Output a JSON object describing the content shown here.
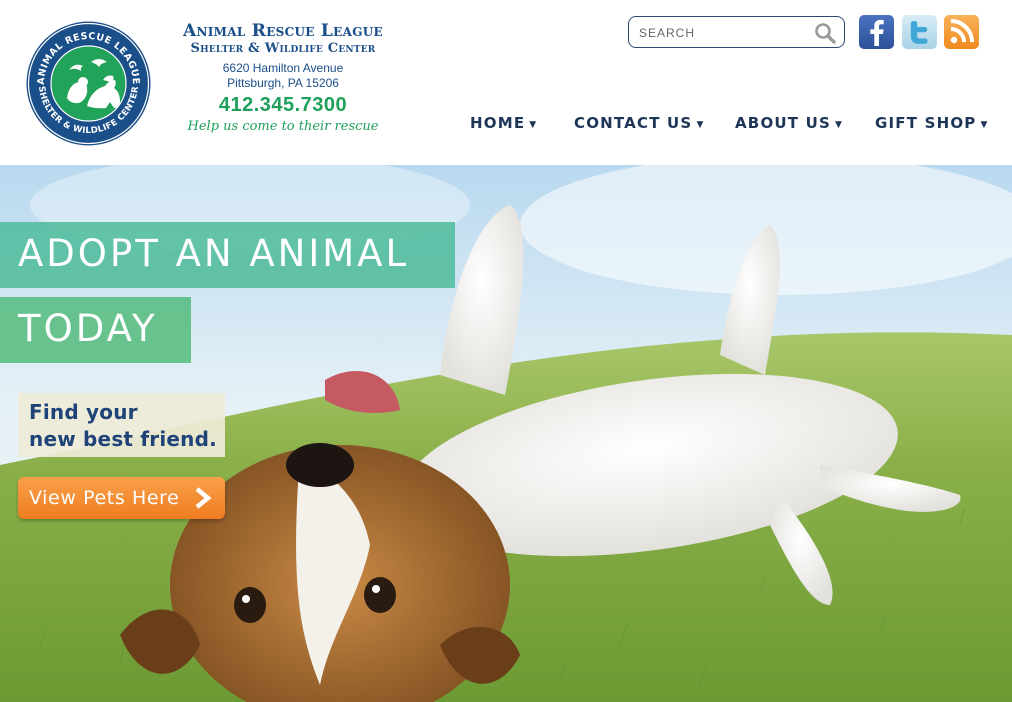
{
  "header": {
    "seal": {
      "ring_top_text": "ANIMAL RESCUE LEAGUE",
      "ring_bottom_text": "SHELTER & WILDLIFE CENTER"
    },
    "org_name": "Animal Rescue League",
    "org_subtitle": "Shelter & Wildlife Center",
    "address_line1": "6620 Hamilton Avenue",
    "address_line2": "Pittsburgh, PA 15206",
    "phone": "412.345.7300",
    "tagline": "Help us come to their rescue",
    "search": {
      "placeholder": "SEARCH",
      "icon": "magnifier-icon"
    },
    "social": [
      {
        "name": "facebook",
        "icon": "facebook-icon",
        "color": "#3b5ea8"
      },
      {
        "name": "twitter",
        "icon": "twitter-icon",
        "color": "#55b7de"
      },
      {
        "name": "rss",
        "icon": "rss-icon",
        "color": "#f28c28"
      }
    ],
    "nav": [
      {
        "label": "HOME"
      },
      {
        "label": "CONTACT US"
      },
      {
        "label": "ABOUT US"
      },
      {
        "label": "GIFT SHOP"
      }
    ],
    "nav_caret": "▼"
  },
  "hero": {
    "headline_line1": "ADOPT AN ANIMAL",
    "headline_line2": "TODAY",
    "subtext_line1": "Find your",
    "subtext_line2": "new best friend.",
    "cta_label": "View Pets Here",
    "cta_icon": "chevron-right-icon"
  },
  "colors": {
    "brand_blue": "#1b4f8a",
    "brand_green": "#1fa05a",
    "nav_text": "#1d3556",
    "banner_teal": "#48ba96",
    "cta_orange": "#f28c28"
  }
}
